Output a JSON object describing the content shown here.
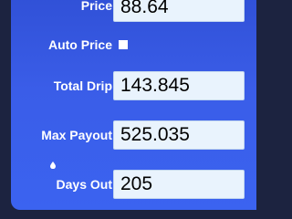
{
  "form": {
    "price": {
      "label": "Price",
      "value": "88.64"
    },
    "auto_price": {
      "label": "Auto Price",
      "checked": false
    },
    "total_drip": {
      "label": "Total Drip",
      "value": "143.845"
    },
    "max_payout": {
      "label": "Max Payout",
      "value": "525.035"
    },
    "days_out": {
      "label": "Days Out",
      "value": "205",
      "icon": "drop-icon"
    }
  },
  "colors": {
    "panel": "#3a5de8",
    "field_bg": "#e9f3fd",
    "label": "#ffffff"
  }
}
